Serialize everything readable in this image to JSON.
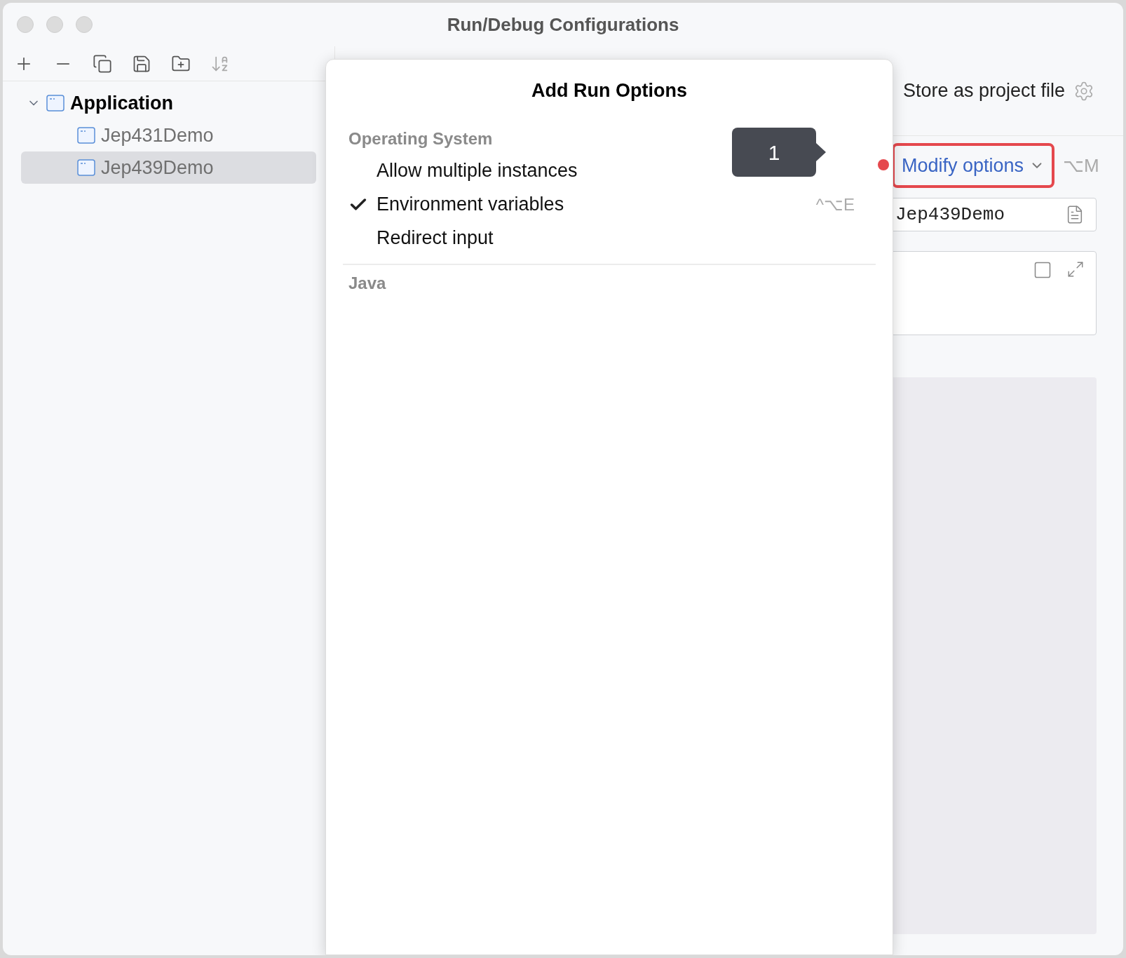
{
  "window": {
    "title": "Run/Debug Configurations"
  },
  "tree": [
    {
      "label": "Application",
      "expanded": true,
      "selected": false,
      "children": [
        {
          "label": "Jep431Demo",
          "selected": false
        },
        {
          "label": "Jep439Demo",
          "selected": true
        }
      ]
    }
  ],
  "popup": {
    "title": "Add Run Options",
    "sections": [
      {
        "heading": "Operating System",
        "items": [
          {
            "label": "Allow multiple instances",
            "checked": false
          },
          {
            "label": "Environment variables",
            "checked": true,
            "shortcut": "^⌥E"
          },
          {
            "label": "Redirect input",
            "checked": false
          }
        ]
      },
      {
        "heading": "Java"
      }
    ]
  },
  "callout": {
    "number": "1"
  },
  "right_panel": {
    "store_label": "Store as project file",
    "modify_button": "Modify options",
    "modify_shortcut": "⌥M",
    "name_field": "Jep439Demo"
  }
}
